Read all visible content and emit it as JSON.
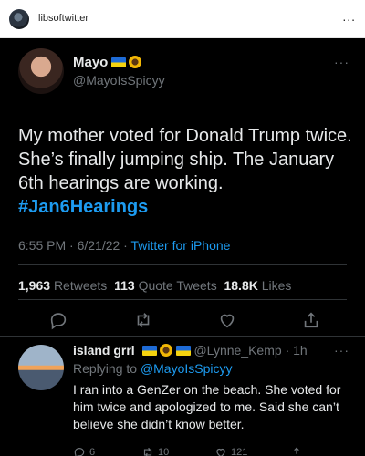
{
  "post": {
    "username": "libsoftwitter",
    "more": "..."
  },
  "tweet": {
    "name": "Mayo",
    "handle": "@MayoIsSpicyy",
    "more": "···",
    "text": "My mother voted for Donald Trump twice. She’s finally jumping ship. The January 6th hearings are working.",
    "hashtag": "#Jan6Hearings",
    "time": "6:55 PM · 6/21/22 · ",
    "source": "Twitter for iPhone",
    "retweets_count": "1,963",
    "retweets_label": "Retweets",
    "quotes_count": "113",
    "quotes_label": "Quote Tweets",
    "likes_count": "18.8K",
    "likes_label": "Likes"
  },
  "reply": {
    "name": "island grrl",
    "handle": "@Lynne_Kemp",
    "time": "· 1h",
    "replying_prefix": "Replying to ",
    "replying_handle": "@MayoIsSpicyy",
    "text": "I ran into a GenZer on the beach. She voted for him twice and apologized to me. Said she can’t believe she didn’t know better.",
    "reply_count": "6",
    "retweet_count": "10",
    "like_count": "121"
  },
  "colors": {
    "background": "#000000",
    "text": "#e7e9ea",
    "muted": "#71767b",
    "accent": "#1d9bf0"
  },
  "icons": [
    "reply-icon",
    "retweet-icon",
    "heart-icon",
    "share-icon",
    "ukraine-flag-icon",
    "sunflower-icon"
  ]
}
